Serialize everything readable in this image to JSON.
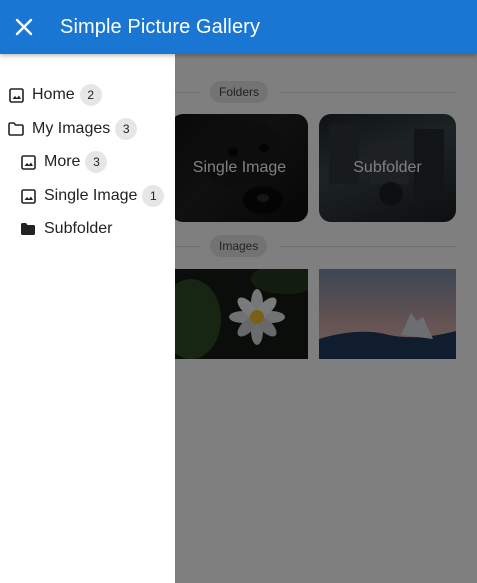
{
  "appbar": {
    "title": "Simple Picture Gallery",
    "close_icon": "close-icon",
    "color": "#1976d2"
  },
  "drawer": {
    "items": [
      {
        "label": "Home",
        "badge": "2",
        "icon": "image-icon"
      },
      {
        "label": "My Images",
        "badge": "3",
        "icon": "folder-outline-icon"
      },
      {
        "label": "More",
        "badge": "3",
        "icon": "image-icon"
      },
      {
        "label": "Single Image",
        "badge": "1",
        "icon": "image-icon"
      },
      {
        "label": "Subfolder",
        "badge": "",
        "icon": "folder-filled-icon"
      }
    ]
  },
  "main": {
    "folders_heading": "Folders",
    "folders": [
      {
        "label": "Single Image"
      },
      {
        "label": "Subfolder"
      }
    ],
    "images_heading": "Images"
  }
}
